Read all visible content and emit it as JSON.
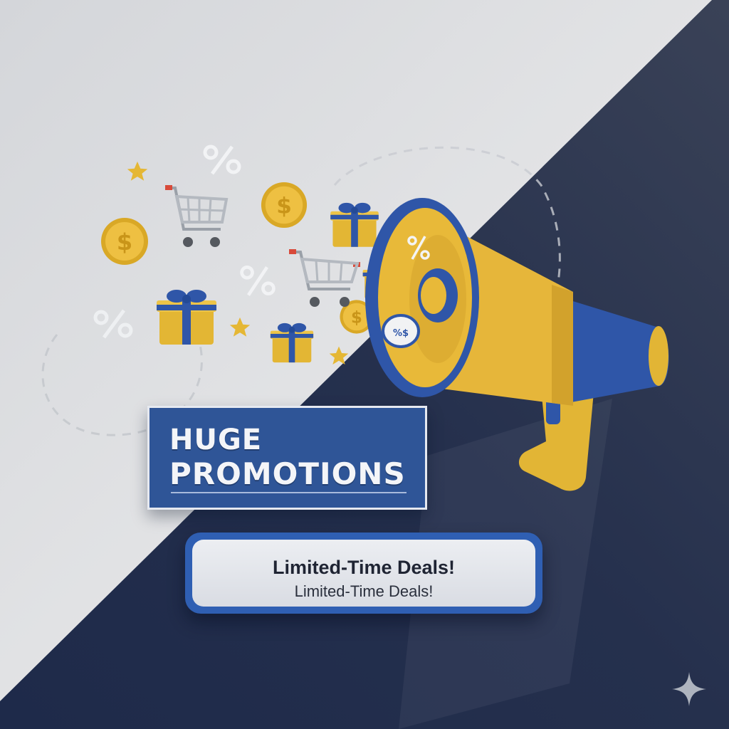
{
  "banner": {
    "line1": "HUGE",
    "line2": "PROMOTIONS"
  },
  "deals": {
    "main_text": "Limited-Time Deals!",
    "sub_text": "Limited-Time Deals!"
  },
  "icons": [
    "star-icon",
    "percent-icon",
    "shopping-cart-icon",
    "dollar-coin-icon",
    "gift-box-icon",
    "megaphone-icon",
    "sparkle-icon"
  ],
  "colors": {
    "navy": "#24304f",
    "light_gray": "#d8dadd",
    "brand_blue": "#2f5597",
    "accent_yellow": "#e3b634"
  }
}
